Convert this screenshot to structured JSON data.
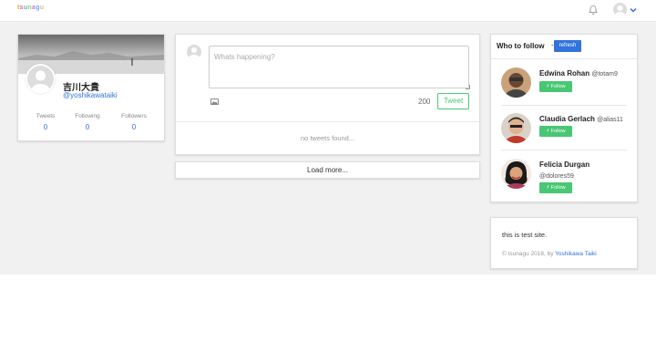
{
  "header": {
    "logo": "tsunagu",
    "logo_colors": [
      "#e8a33d",
      "#e06c75",
      "#56b6c2",
      "#98c379",
      "#c678dd",
      "#61afef",
      "#e5c07b"
    ]
  },
  "profile": {
    "name": "吉川大貴",
    "handle": "@yoshikawataiki",
    "stats": [
      {
        "label": "Tweets",
        "value": "0"
      },
      {
        "label": "Following",
        "value": "0"
      },
      {
        "label": "Followers",
        "value": "0"
      }
    ]
  },
  "composer": {
    "placeholder": "Whats happening?",
    "remaining": "200",
    "tweet_label": "Tweet"
  },
  "feed": {
    "empty_text": "no tweets found...",
    "load_more_label": "Load more..."
  },
  "who_to_follow": {
    "title": "Who to follow",
    "separator": "-",
    "refresh_label": "refresh",
    "users": [
      {
        "name": "Edwina Rohan",
        "handle": "@totam9",
        "follow_label": "Follow"
      },
      {
        "name": "Claudia Gerlach",
        "handle": "@alias11",
        "follow_label": "Follow"
      },
      {
        "name": "Felicia Durgan",
        "handle": "@dolores59",
        "follow_label": "Follow"
      }
    ]
  },
  "about": {
    "text": "this is test site.",
    "copyright": "© tsunagu 2018, by",
    "author": "Yoshikawa Taiki"
  },
  "colors": {
    "accent": "#3273dc",
    "success": "#48c774",
    "background": "#f1f1f1"
  }
}
